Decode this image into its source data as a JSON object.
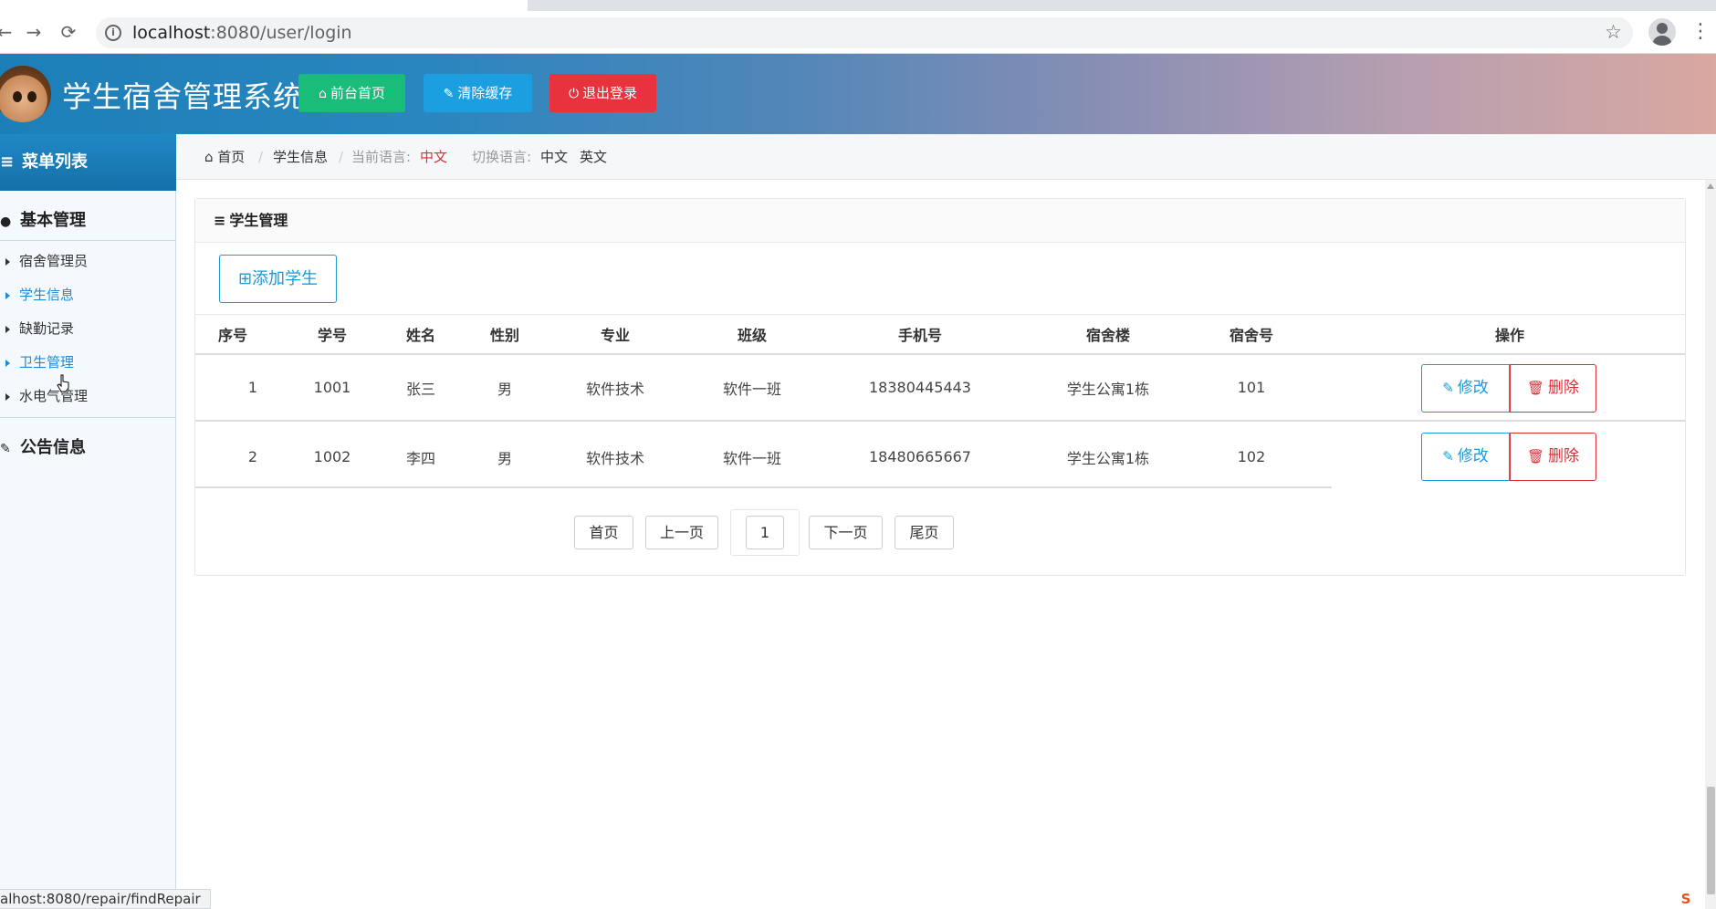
{
  "browser": {
    "url_host": "localhost",
    "url_rest": ":8080/user/login",
    "status_url": "alhost:8080/repair/findRepair"
  },
  "header": {
    "title": "学生宿舍管理系统",
    "buttons": {
      "home": "前台首页",
      "clear_cache": "清除缓存",
      "logout": "退出登录"
    },
    "colors": {
      "home": "#19bc78",
      "clear_cache": "#1c9fe0",
      "logout": "#e8333f"
    }
  },
  "sidebar": {
    "menu_title": "菜单列表",
    "groups": [
      {
        "title": "基本管理",
        "items": [
          {
            "label": "宿舍管理员"
          },
          {
            "label": "学生信息",
            "active": true
          },
          {
            "label": "缺勤记录"
          },
          {
            "label": "卫生管理"
          },
          {
            "label": "水电气管理"
          }
        ]
      },
      {
        "title": "公告信息"
      }
    ]
  },
  "breadcrumb": {
    "home": "首页",
    "current": "学生信息",
    "lang_label": "当前语言:",
    "lang_value": "中文",
    "switch_label": "切换语言:",
    "switch_zh": "中文",
    "switch_en": "英文"
  },
  "panel": {
    "title": "学生管理",
    "add_button": "添加学生",
    "columns": [
      "序号",
      "学号",
      "姓名",
      "性别",
      "专业",
      "班级",
      "手机号",
      "宿舍楼",
      "宿舍号",
      "操作"
    ],
    "rows": [
      [
        "1",
        "1001",
        "张三",
        "男",
        "软件技术",
        "软件一班",
        "18380445443",
        "学生公寓1栋",
        "101"
      ],
      [
        "2",
        "1002",
        "李四",
        "男",
        "软件技术",
        "软件一班",
        "18480665667",
        "学生公寓1栋",
        "102"
      ]
    ],
    "edit_label": "修改",
    "delete_label": "删除"
  },
  "pagination": {
    "first": "首页",
    "prev": "上一页",
    "current": "1",
    "next": "下一页",
    "last": "尾页"
  }
}
